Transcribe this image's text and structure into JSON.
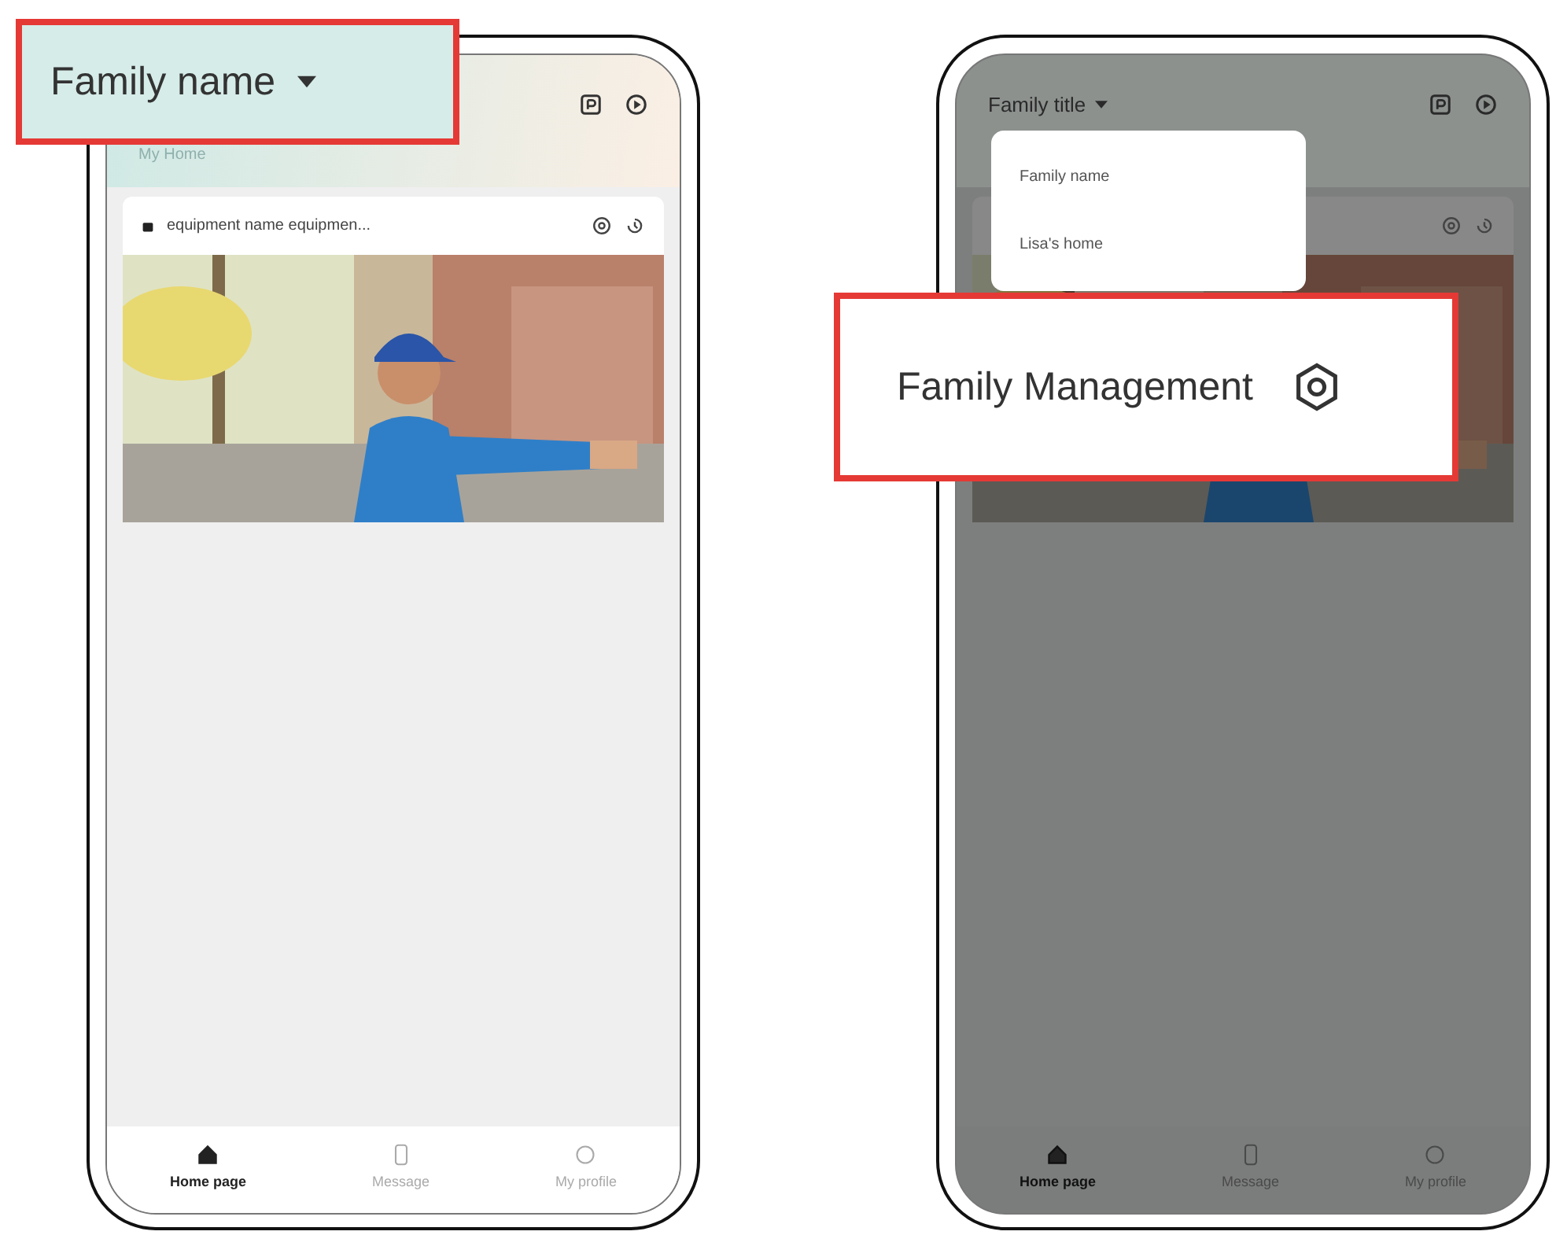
{
  "screens": [
    {
      "dimmed": false,
      "section_label": "My Home",
      "device_name": "equipment name equipmen...",
      "nav": [
        {
          "label": "Home page",
          "selected": true
        },
        {
          "label": "Message",
          "selected": false
        },
        {
          "label": "My profile",
          "selected": false
        }
      ],
      "callout": {
        "kind": "title",
        "text": "Family name"
      }
    },
    {
      "dimmed": true,
      "title": "Family title",
      "menu": {
        "items": [
          "Family name",
          "Lisa's home"
        ]
      },
      "nav": [
        {
          "label": "Home page",
          "selected": true
        },
        {
          "label": "Message",
          "selected": false
        },
        {
          "label": "My profile",
          "selected": false
        }
      ],
      "callout": {
        "kind": "management",
        "text": "Family Management"
      }
    }
  ]
}
